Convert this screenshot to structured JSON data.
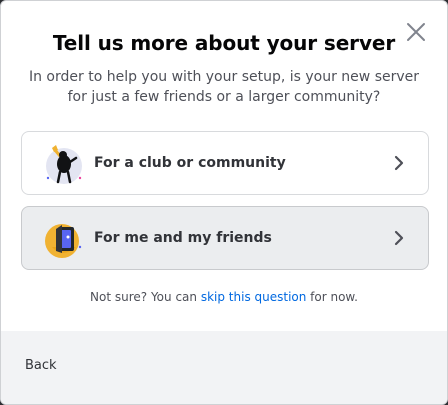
{
  "modal": {
    "title": "Tell us more about your server",
    "subtitle": "In order to help you with your setup, is your new server for just a few friends or a larger community?",
    "close_icon": "close-icon"
  },
  "options": [
    {
      "label": "For a club or community",
      "icon": "club-illustration-icon",
      "selected": false
    },
    {
      "label": "For me and my friends",
      "icon": "friends-illustration-icon",
      "selected": true
    }
  ],
  "note": {
    "prefix": "Not sure? You can ",
    "link": "skip this question",
    "suffix": " for now."
  },
  "footer": {
    "back_label": "Back"
  },
  "colors": {
    "title": "#060607",
    "body_text": "#4e5058",
    "link": "#0068e0",
    "footer_bg": "#f2f3f5",
    "selected_option_bg": "#ebedef"
  }
}
